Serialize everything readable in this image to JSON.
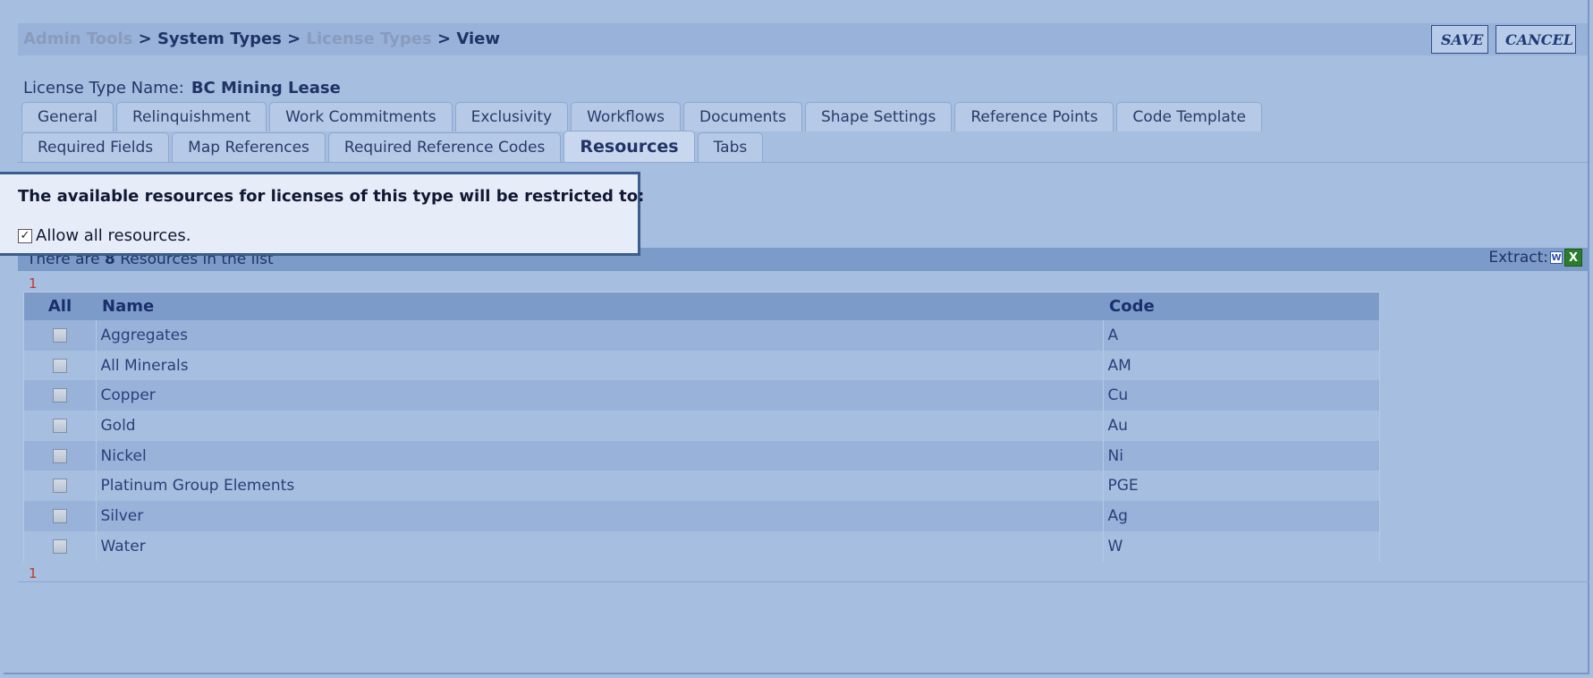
{
  "breadcrumb": {
    "admin_tools": "Admin Tools",
    "sep": " > ",
    "system_types": "System Types",
    "license_types": "License Types",
    "view": "View"
  },
  "actions": {
    "save": "SAVE",
    "cancel": "CANCEL"
  },
  "license_type": {
    "label": "License Type Name:",
    "value": "BC Mining Lease"
  },
  "tabs_row1": [
    "General",
    "Relinquishment",
    "Work Commitments",
    "Exclusivity",
    "Workflows",
    "Documents",
    "Shape Settings",
    "Reference Points",
    "Code Template"
  ],
  "tabs_row2": [
    "Required Fields",
    "Map References",
    "Required Reference Codes",
    "Resources",
    "Tabs"
  ],
  "active_tab": "Resources",
  "callout": {
    "title": "The available resources for licenses of this type will be restricted to:",
    "allow_all_label": "Allow all resources.",
    "allow_all_checked": true
  },
  "list": {
    "count_prefix": "There are ",
    "count": "8",
    "count_suffix": " Resources in the list",
    "extract_label": "Extract:",
    "page": "1",
    "columns": {
      "all": "All",
      "name": "Name",
      "code": "Code"
    },
    "rows": [
      {
        "name": "Aggregates",
        "code": "A"
      },
      {
        "name": "All Minerals",
        "code": "AM"
      },
      {
        "name": "Copper",
        "code": "Cu"
      },
      {
        "name": "Gold",
        "code": "Au"
      },
      {
        "name": "Nickel",
        "code": "Ni"
      },
      {
        "name": "Platinum Group Elements",
        "code": "PGE"
      },
      {
        "name": "Silver",
        "code": "Ag"
      },
      {
        "name": "Water",
        "code": "W"
      }
    ]
  },
  "icons": {
    "word": "word-icon",
    "excel": "excel-icon"
  },
  "colors": {
    "background": "#a6bedf",
    "header": "#98b2da",
    "accent": "#1f3366",
    "pager": "#c0392b"
  }
}
